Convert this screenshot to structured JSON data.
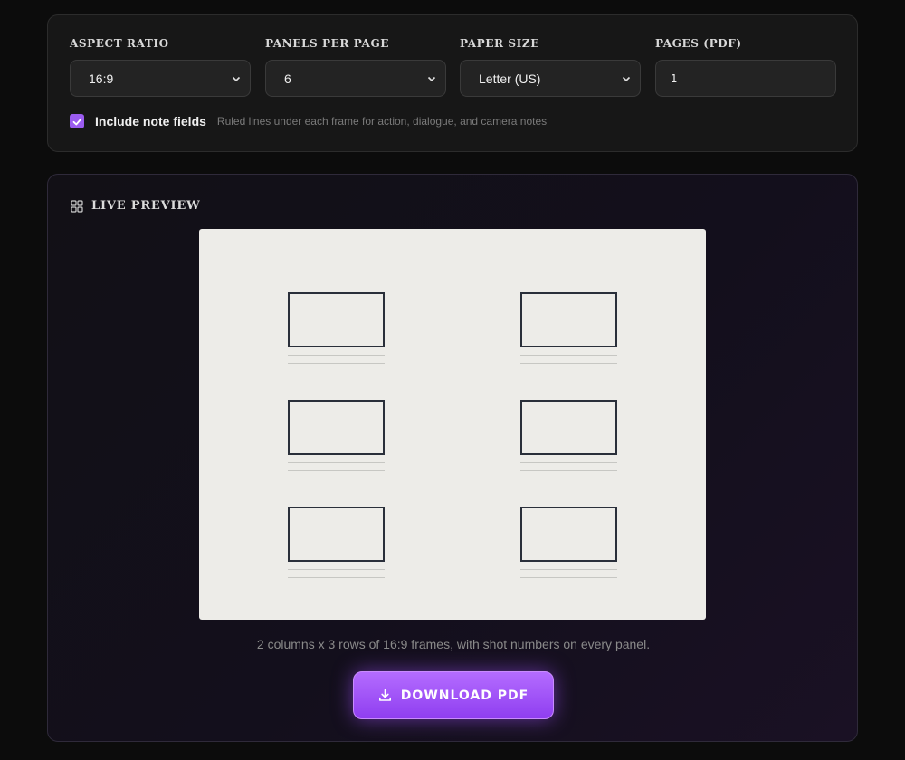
{
  "settings": {
    "aspect_ratio": {
      "label": "ASPECT RATIO",
      "value": "16:9"
    },
    "panels_per_page": {
      "label": "PANELS PER PAGE",
      "value": "6"
    },
    "paper_size": {
      "label": "PAPER SIZE",
      "value": "Letter (US)"
    },
    "pages": {
      "label": "PAGES (PDF)",
      "value": "1"
    },
    "note_fields": {
      "checked": true,
      "label": "Include note fields",
      "help": "Ruled lines under each frame for action, dialogue, and camera notes"
    }
  },
  "preview": {
    "title": "LIVE PREVIEW",
    "caption": "2 columns x 3 rows of 16:9 frames, with shot numbers on every panel.",
    "columns": 2,
    "rows": 3
  },
  "download": {
    "label": "DOWNLOAD PDF"
  },
  "colors": {
    "accent": "#9b5cf0",
    "button_top": "#b46cff",
    "button_bottom": "#8f3ef0",
    "paper": "#edece8",
    "frame_border": "#2a2f3a"
  },
  "icons": {
    "select": "chevron-down-icon",
    "checkbox": "check-icon",
    "preview": "grid-icon",
    "download": "download-icon"
  }
}
